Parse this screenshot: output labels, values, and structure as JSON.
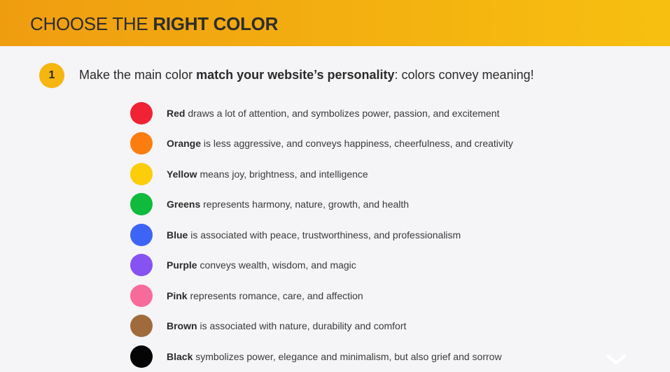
{
  "header": {
    "title_regular": "CHOOSE THE ",
    "title_bold": "RIGHT COLOR",
    "gradient_start": "#ef9d10",
    "gradient_end": "#f7c010"
  },
  "step": {
    "number": "1",
    "text_before": "Make the main color ",
    "text_bold": "match your website’s personality",
    "text_after": ": colors convey meaning!",
    "badge_color": "#f6b50f"
  },
  "colors": [
    {
      "name": "Red",
      "description": " draws a lot of attention, and symbolizes power, passion, and excitement",
      "swatch": "#f02233"
    },
    {
      "name": "Orange",
      "description": " is less aggressive, and conveys happiness, cheerfulness, and creativity",
      "swatch": "#fb7d10"
    },
    {
      "name": "Yellow",
      "description": " means joy, brightness, and intelligence",
      "swatch": "#fccd0a"
    },
    {
      "name": "Greens",
      "description": " represents harmony, nature, growth, and health",
      "swatch": "#0fba3d"
    },
    {
      "name": "Blue",
      "description": " is associated with peace, trustworthiness, and professionalism",
      "swatch": "#3e64f5"
    },
    {
      "name": "Purple",
      "description": " conveys wealth, wisdom, and magic",
      "swatch": "#8752f2"
    },
    {
      "name": "Pink",
      "description": " represents romance, care, and affection",
      "swatch": "#f76b9b"
    },
    {
      "name": "Brown",
      "description": " is associated with nature, durability and comfort",
      "swatch": "#a06b3c"
    },
    {
      "name": "Black",
      "description": " symbolizes power, elegance and minimalism, but also grief and sorrow",
      "swatch": "#050505"
    }
  ],
  "corner_icon": "watermark-x-icon"
}
